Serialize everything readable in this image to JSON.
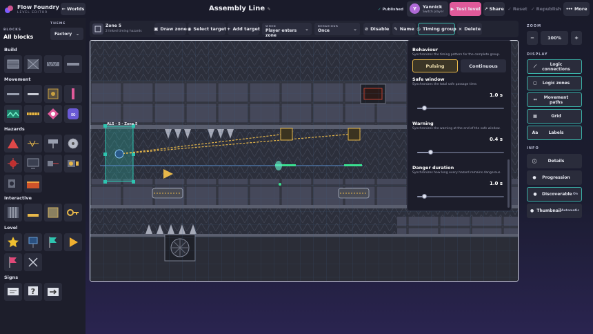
{
  "app": {
    "name": "Flow Foundry",
    "subtitle": "LEVEL EDITOR",
    "worlds_label": "Worlds"
  },
  "page_title": "Assembly Line",
  "status": {
    "published": "Published"
  },
  "user": {
    "initial": "Y",
    "name": "Yannick",
    "action": "Switch player"
  },
  "top_actions": {
    "test": "Test level",
    "share": "Share",
    "reset": "Reset",
    "republish": "Republish",
    "more": "More"
  },
  "sidebar": {
    "blocks_label": "BLOCKS",
    "blocks_title": "All blocks",
    "theme_label": "THEME",
    "theme_value": "Factory",
    "sections": [
      "Build",
      "Movement",
      "Hazards",
      "Interactive",
      "Level",
      "Signs"
    ]
  },
  "toolbar": {
    "zone_name": "Zone 5",
    "zone_sub": "2 linked timing hazards",
    "draw_zone": "Draw zone",
    "select_target": "Select target",
    "add_target": "Add target",
    "when_label": "WHEN",
    "when_value": "Player enters zone",
    "behaviour_label": "BEHAVIOUR",
    "behaviour_value": "Once",
    "disable": "Disable",
    "name": "Name",
    "timing_group": "Timing group",
    "delete": "Delete"
  },
  "canvas": {
    "zone_label": "ALS - 5 - Zone 5"
  },
  "timing": {
    "behaviour_title": "Behaviour",
    "behaviour_desc": "Synchronizes the timing pattern for the complete group.",
    "pulsing": "Pulsing",
    "continuous": "Continuous",
    "safe_title": "Safe window",
    "safe_desc": "Synchronizes the total safe passage time.",
    "safe_value": "1.0 s",
    "safe_level": 0.08,
    "warning_title": "Warning",
    "warning_desc": "Synchronizes the warning at the end of the safe window.",
    "warning_value": "0.4 s",
    "warning_level": 0.15,
    "danger_title": "Danger duration",
    "danger_desc": "Synchronizes how long every hazard remains dangerous.",
    "danger_value": "1.0 s",
    "danger_level": 0.08
  },
  "right_panel": {
    "zoom_label": "ZOOM",
    "zoom_value": "100%",
    "display_label": "DISPLAY",
    "display_items": [
      "Logic connections",
      "Logic zones",
      "Movement paths",
      "Grid",
      "Labels"
    ],
    "info_label": "INFO",
    "info_items": [
      "Details",
      "Progression",
      "Discoverable",
      "Thumbnail"
    ],
    "discoverable_state": "On",
    "thumbnail_state": "Automatic"
  },
  "colors": {
    "accent": "#3bb3a9",
    "test": "#e05a9a",
    "gold": "#e8b84a",
    "zone": "#2ec4b0"
  }
}
